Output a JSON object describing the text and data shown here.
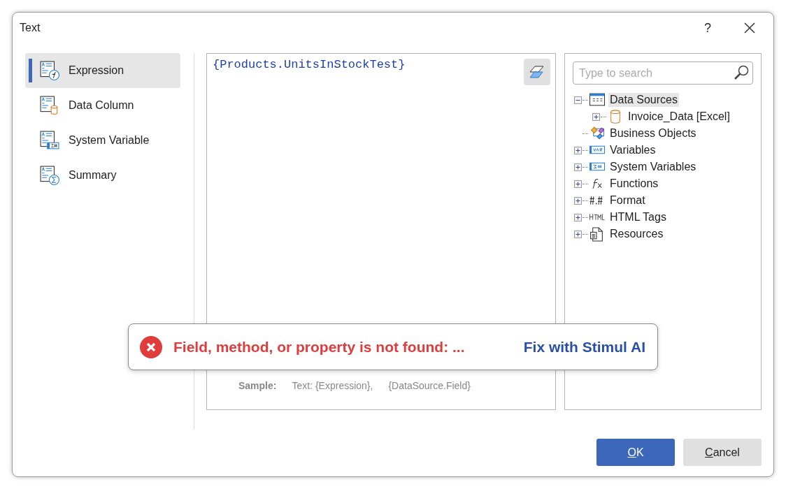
{
  "window": {
    "title": "Text",
    "help": "?"
  },
  "sidebar": {
    "items": [
      {
        "label": "Expression",
        "kind": "expression",
        "selected": true
      },
      {
        "label": "Data Column",
        "kind": "column",
        "selected": false
      },
      {
        "label": "System Variable",
        "kind": "sysvar",
        "selected": false
      },
      {
        "label": "Summary",
        "kind": "summary",
        "selected": false
      }
    ]
  },
  "editor": {
    "value": "{Products.UnitsInStockTest}",
    "sample_label": "Sample:",
    "samples": [
      "Text: {Expression},",
      "{DataSource.Field}"
    ]
  },
  "tree": {
    "search": {
      "placeholder": "Type to search"
    },
    "items": [
      {
        "label": "Data Sources",
        "kind": "datasources",
        "expanded": true,
        "selected": true,
        "children": [
          {
            "label": "Invoice_Data [Excel]",
            "kind": "database",
            "expanded": false,
            "selected": false
          }
        ]
      },
      {
        "label": "Business Objects",
        "kind": "business",
        "selected": false
      },
      {
        "label": "Variables",
        "kind": "variables",
        "expanded": false,
        "selected": false
      },
      {
        "label": "System Variables",
        "kind": "sysvars",
        "expanded": false,
        "selected": false
      },
      {
        "label": "Functions",
        "kind": "functions",
        "expanded": false,
        "selected": false
      },
      {
        "label": "Format",
        "kind": "format",
        "expanded": false,
        "selected": false
      },
      {
        "label": "HTML Tags",
        "kind": "html",
        "expanded": false,
        "selected": false
      },
      {
        "label": "Resources",
        "kind": "resources",
        "expanded": false,
        "selected": false
      }
    ]
  },
  "error": {
    "message": "Field, method, or property is not found: ...",
    "action": "Fix with Stimul AI"
  },
  "buttons": [
    {
      "label": "OK",
      "kind": "primary"
    },
    {
      "label": "Cancel",
      "kind": "secondary"
    }
  ]
}
